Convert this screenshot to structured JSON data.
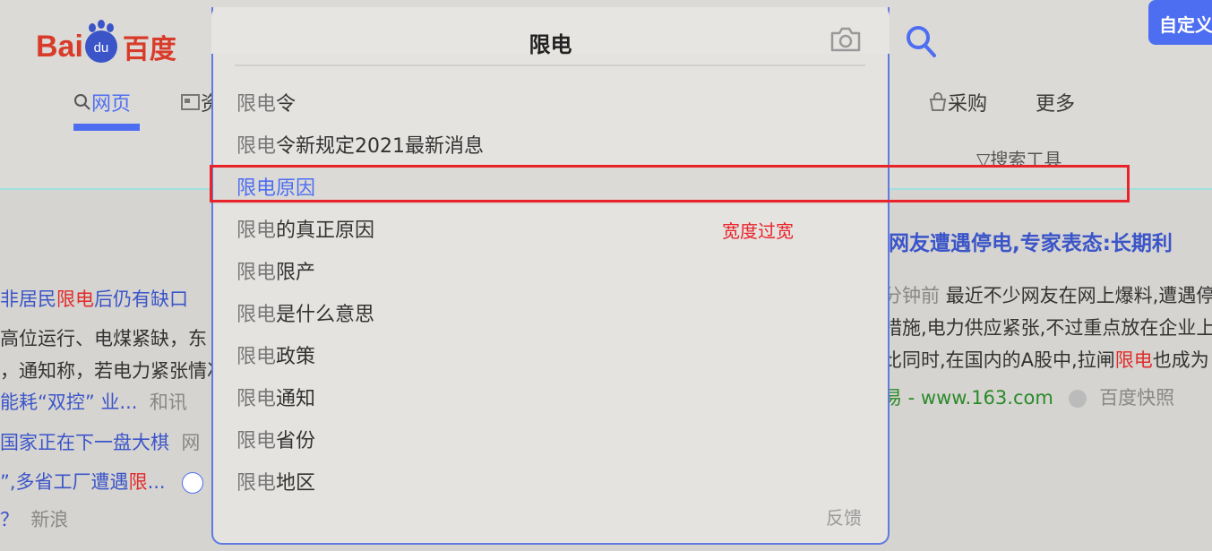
{
  "header": {
    "logo_text_latin": "Bai",
    "logo_text_paw": "du",
    "logo_text_cn": "百度",
    "custom_button": "自定义",
    "search_tools": "搜索工具"
  },
  "nav": [
    {
      "label": "网页",
      "icon": "search-icon"
    },
    {
      "label": "资",
      "icon": "news-icon"
    },
    {
      "label": "采购",
      "icon": "shopping-bag-icon"
    },
    {
      "label": "更多"
    }
  ],
  "search": {
    "query": "限电"
  },
  "suggestions": [
    {
      "highlight": "限电",
      "rest": "令"
    },
    {
      "highlight": "限电",
      "rest": "令新规定2021最新消息"
    },
    {
      "highlight": "限电",
      "rest": "原因"
    },
    {
      "highlight": "限电",
      "rest": "的真正原因"
    },
    {
      "highlight": "限电",
      "rest": "限产"
    },
    {
      "highlight": "限电",
      "rest": "是什么意思"
    },
    {
      "highlight": "限电",
      "rest": "政策"
    },
    {
      "highlight": "限电",
      "rest": "通知"
    },
    {
      "highlight": "限电",
      "rest": "省份"
    },
    {
      "highlight": "限电",
      "rest": "地区"
    }
  ],
  "feedback": "反馈",
  "annotation": "宽度过宽",
  "results_left": {
    "line1_pre": "非居民",
    "line1_hl": "限电",
    "line1_post": "后仍有缺口",
    "line2": "高位运行、电煤紧缺，东",
    "line3": "，通知称，若电力紧张情况",
    "line4_link": "能耗“双控” 业...",
    "line4_source": "和讯",
    "line5_link": "国家正在下一盘大棋",
    "line5_source": "网",
    "line6_pre": "”,多省工厂遭遇",
    "line6_hl": "限",
    "line6_post": "...",
    "line7_pre": "？",
    "line7_source": "新浪"
  },
  "results_right": {
    "title": "网友遭遇停电,专家表态:长期利",
    "time": "分钟前",
    "line1": "最近不少网友在网上爆料,遭遇停",
    "line2": "措施,电力供应紧张,不过重点放在企业上",
    "line3_pre": "比同时,在国内的A股中,拉闸",
    "line3_hl": "限电",
    "line3_post": "也成为",
    "source_url": "易 - www.163.com",
    "snapshot": "百度快照"
  }
}
